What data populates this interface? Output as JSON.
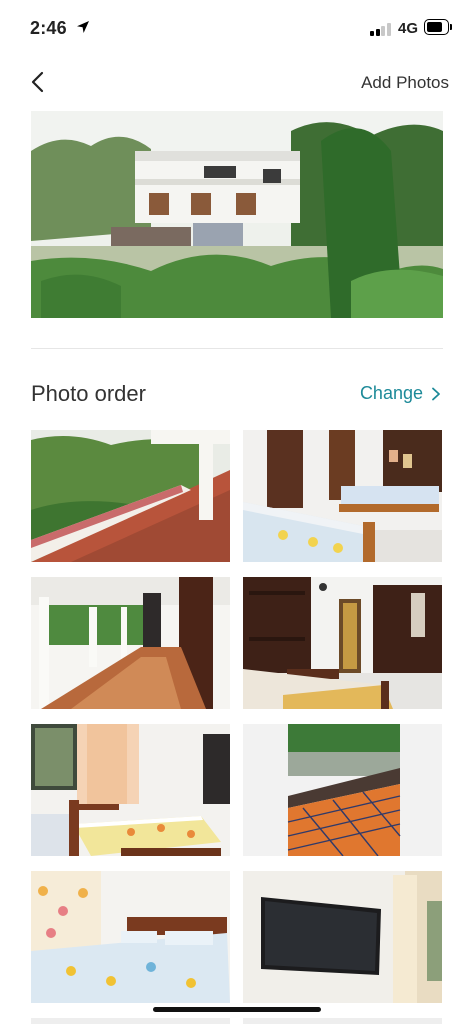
{
  "status_bar": {
    "time": "2:46",
    "network": "4G",
    "battery_level": 0.8,
    "location_icon": "location-arrow-icon",
    "signal_icon": "cell-signal-icon"
  },
  "nav": {
    "back_icon": "chevron-left-icon",
    "add_photos_label": "Add Photos"
  },
  "section": {
    "title": "Photo order",
    "change_label": "Change",
    "change_icon": "chevron-right-icon"
  },
  "photos": [
    {
      "subject": "house exterior with garden"
    },
    {
      "subject": "balcony overlooking trees"
    },
    {
      "subject": "bedroom with wooden bed"
    },
    {
      "subject": "veranda with tiled floor"
    },
    {
      "subject": "bedroom with wardrobe"
    },
    {
      "subject": "bedroom with floral curtains"
    },
    {
      "subject": "tiled terrace"
    },
    {
      "subject": "bedroom with carved bed"
    },
    {
      "subject": "wall-mounted television"
    }
  ],
  "colors": {
    "accent": "#1d8a99",
    "text": "#333333"
  }
}
